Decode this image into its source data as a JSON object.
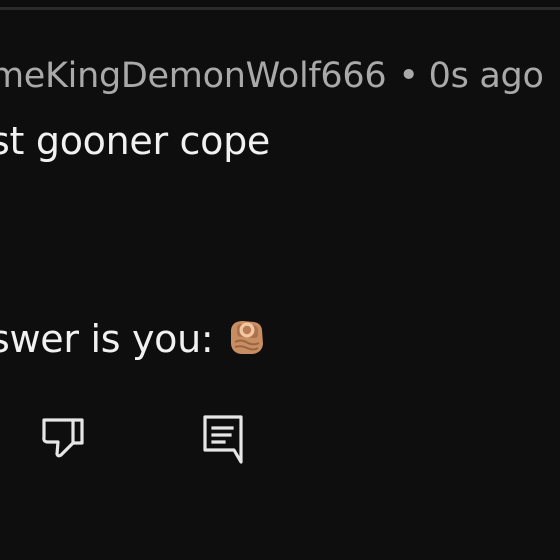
{
  "comment": {
    "author": "meKingDemonWolf666",
    "separator": "•",
    "timestamp": "0s ago",
    "lines": [
      "st gooner cope",
      "swer is you:"
    ],
    "emoji": "pointing-at-viewer-icon"
  },
  "actions": {
    "dislike_icon": "thumbs-down-icon",
    "reply_icon": "reply-comment-icon"
  },
  "colors": {
    "background": "#0e0e0e",
    "meta_text": "#a9a9a9",
    "body_text": "#f1f1f1",
    "icon": "#e6e6e6",
    "skin_tone": "#c98d62"
  }
}
